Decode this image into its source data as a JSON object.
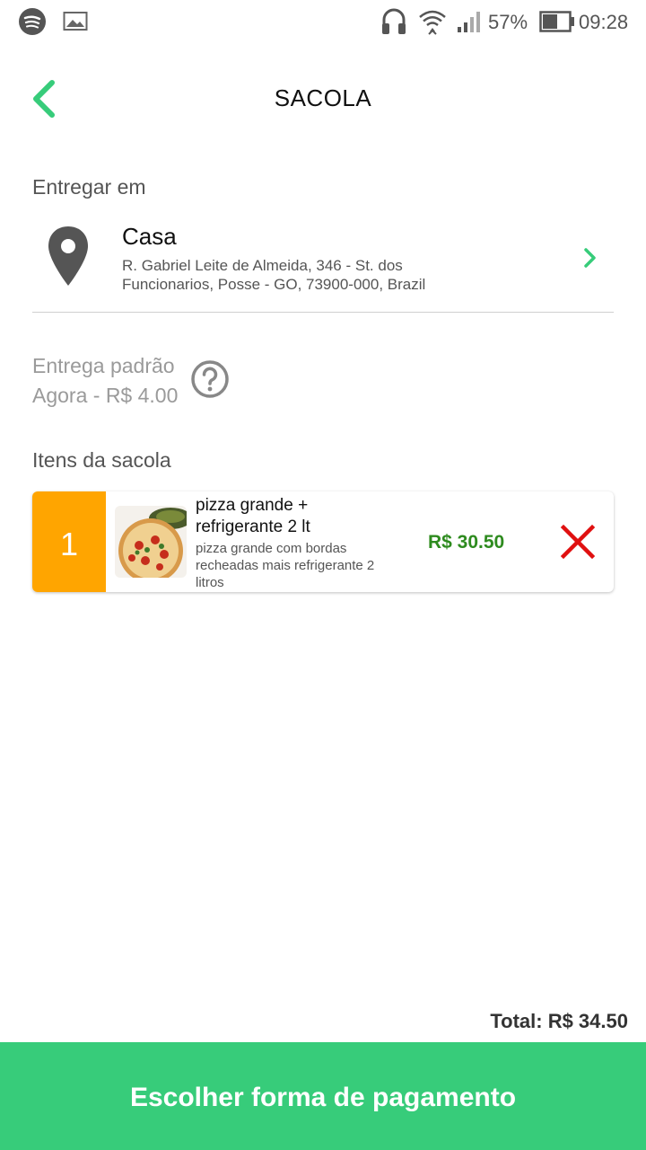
{
  "status_bar": {
    "battery_percent": "57%",
    "time": "09:28",
    "icons": [
      "spotify-icon",
      "image-icon",
      "headphones-icon",
      "wifi-icon",
      "signal-icon",
      "battery-icon"
    ]
  },
  "header": {
    "title": "SACOLA",
    "back_icon": "chevron-left-icon"
  },
  "delivery_address": {
    "section_label": "Entregar em",
    "name": "Casa",
    "line1": "R. Gabriel Leite de Almeida, 346 - St. dos",
    "line2": "Funcionarios, Posse - GO, 73900-000, Brazil"
  },
  "delivery_option": {
    "line1": "Entrega padrão",
    "line2": "Agora - R$ 4.00",
    "help_icon": "question-circle-icon"
  },
  "items_section": {
    "label": "Itens da sacola",
    "items": [
      {
        "quantity": "1",
        "name_line1": "pizza grande +",
        "name_line2": "refrigerante 2 lt",
        "desc_line1": "pizza grande com bordas",
        "desc_line2": "recheadas mais refrigerante 2",
        "desc_line3": "litros",
        "price": "R$ 30.50"
      }
    ]
  },
  "footer": {
    "total": "Total: R$ 34.50",
    "pay_button": "Escolher forma de pagamento"
  },
  "colors": {
    "accent_green": "#37cc7a",
    "price_green": "#2e8b1f",
    "quantity_orange": "#FFA500",
    "remove_red": "#e01010"
  }
}
